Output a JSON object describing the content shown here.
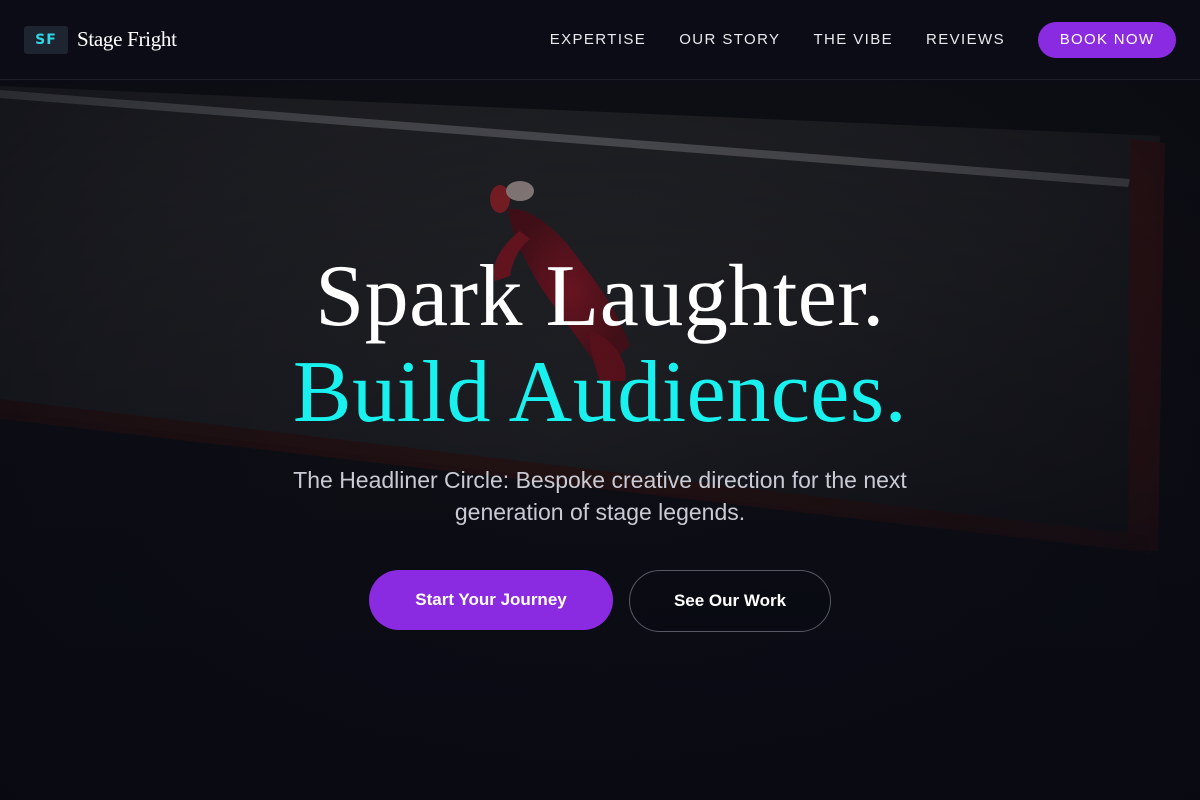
{
  "brand": {
    "badge": "SF",
    "name": "Stage Fright"
  },
  "nav": {
    "links": [
      {
        "label": "EXPERTISE"
      },
      {
        "label": "OUR STORY"
      },
      {
        "label": "THE VIBE"
      },
      {
        "label": "REVIEWS"
      }
    ],
    "cta_label": "BOOK NOW"
  },
  "hero": {
    "headline_line1": "Spark Laughter.",
    "headline_line2": "Build Audiences.",
    "subhead": "The Headliner Circle: Bespoke creative direction for the next generation of stage legends.",
    "primary_cta": "Start Your Journey",
    "secondary_cta": "See Our Work",
    "background_image": "dark stage floor with small red-costumed figure"
  },
  "colors": {
    "background": "#0b0c15",
    "accent_purple": "#8a2be2",
    "accent_cyan": "#19f1ef",
    "text_muted": "#c9cad3"
  }
}
